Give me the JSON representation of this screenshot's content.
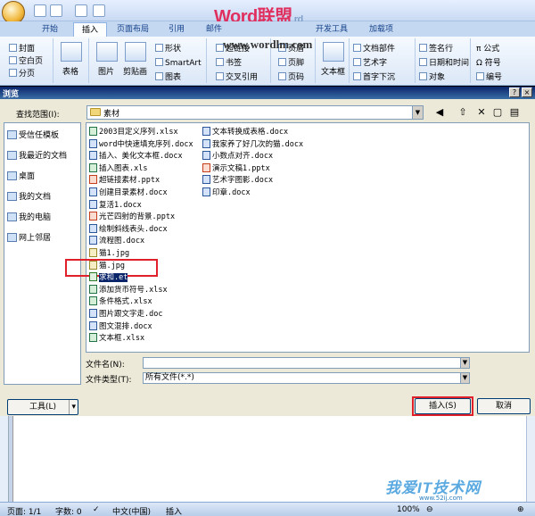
{
  "watermark": {
    "title": "Word联盟",
    "title_suffix": "rd",
    "url": "www.wordlm.com",
    "bottom_site": "我爱IT技术网",
    "bottom_site_url": "www.52ij.com"
  },
  "ribbon": {
    "tabs": [
      "开始",
      "插入",
      "页面布局",
      "引用",
      "邮件",
      "开发工具",
      "加载项"
    ],
    "active_tab": "插入",
    "groups": {
      "pages": [
        "封面",
        "空白页",
        "分页"
      ],
      "table": "表格",
      "illustrations": [
        "图片",
        "剪贴画",
        "形状",
        "SmartArt",
        "图表"
      ],
      "links": [
        "超链接",
        "书签",
        "交叉引用"
      ],
      "header": [
        "页眉",
        "页脚",
        "页码"
      ],
      "textbox": "文本框",
      "text": [
        "文档部件",
        "艺术字",
        "首字下沉"
      ],
      "text2": [
        "签名行",
        "日期和时间",
        "对象"
      ],
      "symbols": [
        "公式",
        "符号",
        "编号"
      ]
    }
  },
  "dialog": {
    "title": "浏览",
    "lookin_label": "查找范围(I):",
    "lookin_value": "素材",
    "places": [
      "受信任模板",
      "我最近的文档",
      "桌面",
      "我的文档",
      "我的电脑",
      "网上邻居"
    ],
    "files_col1": [
      {
        "name": "2003目定义序列.xlsx",
        "type": "excel"
      },
      {
        "name": "word中快速填充序列.docx",
        "type": "word"
      },
      {
        "name": "插入、美化文本框.docx",
        "type": "word"
      },
      {
        "name": "插入图表.xls",
        "type": "excel"
      },
      {
        "name": "超链接素材.pptx",
        "type": "ppt"
      },
      {
        "name": "创建目录素材.docx",
        "type": "word"
      },
      {
        "name": "复活1.docx",
        "type": "word"
      },
      {
        "name": "光芒四射的背景.pptx",
        "type": "ppt"
      },
      {
        "name": "绘制斜线表头.docx",
        "type": "word"
      },
      {
        "name": "流程图.docx",
        "type": "word"
      },
      {
        "name": "猫1.jpg",
        "type": "img"
      },
      {
        "name": "猫.jpg",
        "type": "img"
      },
      {
        "name": "求和.et",
        "type": "et",
        "selected": true
      },
      {
        "name": "添加货币符号.xlsx",
        "type": "excel"
      },
      {
        "name": "条件格式.xlsx",
        "type": "excel"
      },
      {
        "name": "图片跟文字走.doc",
        "type": "word"
      },
      {
        "name": "图文混排.docx",
        "type": "word"
      },
      {
        "name": "文本框.xlsx",
        "type": "excel"
      }
    ],
    "files_col2": [
      {
        "name": "文本转换成表格.docx",
        "type": "word"
      },
      {
        "name": "我家养了好几次的猫.docx",
        "type": "word"
      },
      {
        "name": "小数点对齐.docx",
        "type": "word"
      },
      {
        "name": "演示文稿1.pptx",
        "type": "ppt"
      },
      {
        "name": "艺术字图影.docx",
        "type": "word"
      },
      {
        "name": "印章.docx",
        "type": "word"
      }
    ],
    "filename_label": "文件名(N):",
    "filename_value": "",
    "filetype_label": "文件类型(T):",
    "filetype_value": "所有文件(*.*)",
    "tools_label": "工具(L)",
    "insert_label": "插入(S)",
    "cancel_label": "取消"
  },
  "statusbar": {
    "page": "页面: 1/1",
    "words": "字数: 0",
    "language": "中文(中国)",
    "mode": "插入",
    "zoom": "100%"
  },
  "colors": {
    "highlight_red": "#e0202a",
    "selection": "#0a246a",
    "titlebar": "#0a246a"
  }
}
